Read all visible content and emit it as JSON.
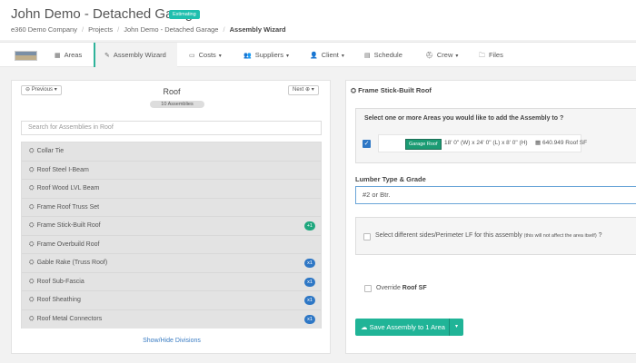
{
  "header": {
    "title": "John Demo - Detached Garage",
    "status_badge": "Estimating",
    "breadcrumbs": [
      "e360 Demo Company",
      "Projects",
      "John Demo - Detached Garage",
      "Assembly Wizard"
    ]
  },
  "nav": {
    "items": [
      {
        "label": "Areas",
        "icon": "grid-icon",
        "active": false,
        "dropdown": false
      },
      {
        "label": "Assembly Wizard",
        "icon": "wand-icon",
        "active": true,
        "dropdown": false
      },
      {
        "label": "Costs",
        "icon": "money-icon",
        "active": false,
        "dropdown": true
      },
      {
        "label": "Suppliers",
        "icon": "users-icon",
        "active": false,
        "dropdown": true
      },
      {
        "label": "Client",
        "icon": "user-icon",
        "active": false,
        "dropdown": true
      },
      {
        "label": "Schedule",
        "icon": "calendar-icon",
        "active": false,
        "dropdown": false
      },
      {
        "label": "Crew",
        "icon": "crew-icon",
        "active": false,
        "dropdown": true
      },
      {
        "label": "Files",
        "icon": "folder-icon",
        "active": false,
        "dropdown": false
      }
    ]
  },
  "left_panel": {
    "prev_label": "Previous",
    "next_label": "Next",
    "title": "Roof",
    "count": "10 Assemblies",
    "search_placeholder": "Search for Assemblies in Roof",
    "assemblies": [
      {
        "name": "Collar Tie",
        "badge": ""
      },
      {
        "name": "Roof Steel I-Beam",
        "badge": ""
      },
      {
        "name": "Roof Wood LVL Beam",
        "badge": ""
      },
      {
        "name": "Frame Roof Truss Set",
        "badge": ""
      },
      {
        "name": "Frame Stick-Built Roof",
        "badge": "+1",
        "badge_color": "#1fa77e"
      },
      {
        "name": "Frame Overbuild Roof",
        "badge": ""
      },
      {
        "name": "Gable Rake (Truss Roof)",
        "badge": "x1",
        "badge_color": "#2e77c5"
      },
      {
        "name": "Roof Sub-Fascia",
        "badge": "x1",
        "badge_color": "#2e77c5"
      },
      {
        "name": "Roof Sheathing",
        "badge": "x1",
        "badge_color": "#2e77c5"
      },
      {
        "name": "Roof Metal Connectors",
        "badge": "x1",
        "badge_color": "#2e77c5"
      }
    ],
    "show_hide_label": "Show/Hide Divisions"
  },
  "right_panel": {
    "title": "Frame Stick-Built Roof",
    "areas_prompt": "Select one or more Areas you would like to add the Assembly to",
    "area": {
      "name": "Garage Roof",
      "dimensions": "18' 0\" (W) x 24' 0\" (L) x 8' 0\" (H)",
      "size": "640.949 Roof SF",
      "checked": true
    },
    "lumber_label": "Lumber Type & Grade",
    "lumber_value": "#2 or Btr.",
    "perimeter_label": "Select different sides/Perimeter LF for this assembly",
    "perimeter_note": "(this will not affect the area itself)",
    "override_prefix": "Override",
    "override_bold": "Roof SF",
    "save_label": "Save Assembly to 1 Area"
  },
  "colors": {
    "accent": "#20b497",
    "badge_blue": "#2e77c5",
    "badge_green": "#1fa77e",
    "link": "#3a7cc3"
  }
}
